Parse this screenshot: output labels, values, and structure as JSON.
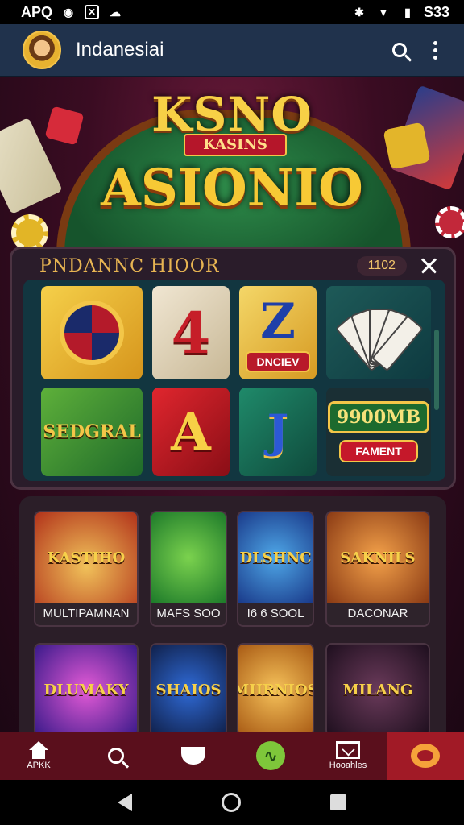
{
  "status_bar": {
    "left_text": "APQ",
    "right_text": "S33"
  },
  "app_bar": {
    "title": "Indanesiai"
  },
  "banner": {
    "logo_top": "KSNO",
    "logo_ribbon": "KASINS",
    "logo_main": "ASIONIO"
  },
  "promo": {
    "title": "PNDANNC HIOOR",
    "code": "1102",
    "tiles": {
      "t2_symbol": "4",
      "t3_symbol": "Z",
      "t3_label": "DNCIEV",
      "t5_label": "SEDGRAL",
      "t6_symbol": "A",
      "t7_symbol": "J",
      "t8_amount": "9900MB",
      "t8_button": "FAMENT"
    }
  },
  "games": [
    {
      "art": "KASTIHO",
      "caption": "MULTIPAMNAN"
    },
    {
      "art": "",
      "caption": "MAFS SOO"
    },
    {
      "art": "DLSHNC",
      "caption": "I6 6 SOOL"
    },
    {
      "art": "SAKNILS",
      "caption": "DACONAR"
    },
    {
      "art": "DLUMAKY",
      "caption": ""
    },
    {
      "art": "SHAIOS",
      "caption": ""
    },
    {
      "art": "MIIRNIOS",
      "caption": ""
    },
    {
      "art": "MILANG",
      "caption": ""
    }
  ],
  "bottom_nav": [
    {
      "label": "APKK",
      "icon": "home-icon"
    },
    {
      "label": "",
      "icon": "search-icon"
    },
    {
      "label": "",
      "icon": "cup-icon"
    },
    {
      "label": "",
      "icon": "trend-icon"
    },
    {
      "label": "Hooahles",
      "icon": "mail-icon"
    },
    {
      "label": "",
      "icon": "chat-icon"
    }
  ],
  "colors": {
    "app_bar": "#20324c",
    "accent_gold": "#f3c648",
    "nav_bg": "#5a0f1c",
    "nav_active": "#a11a26"
  }
}
